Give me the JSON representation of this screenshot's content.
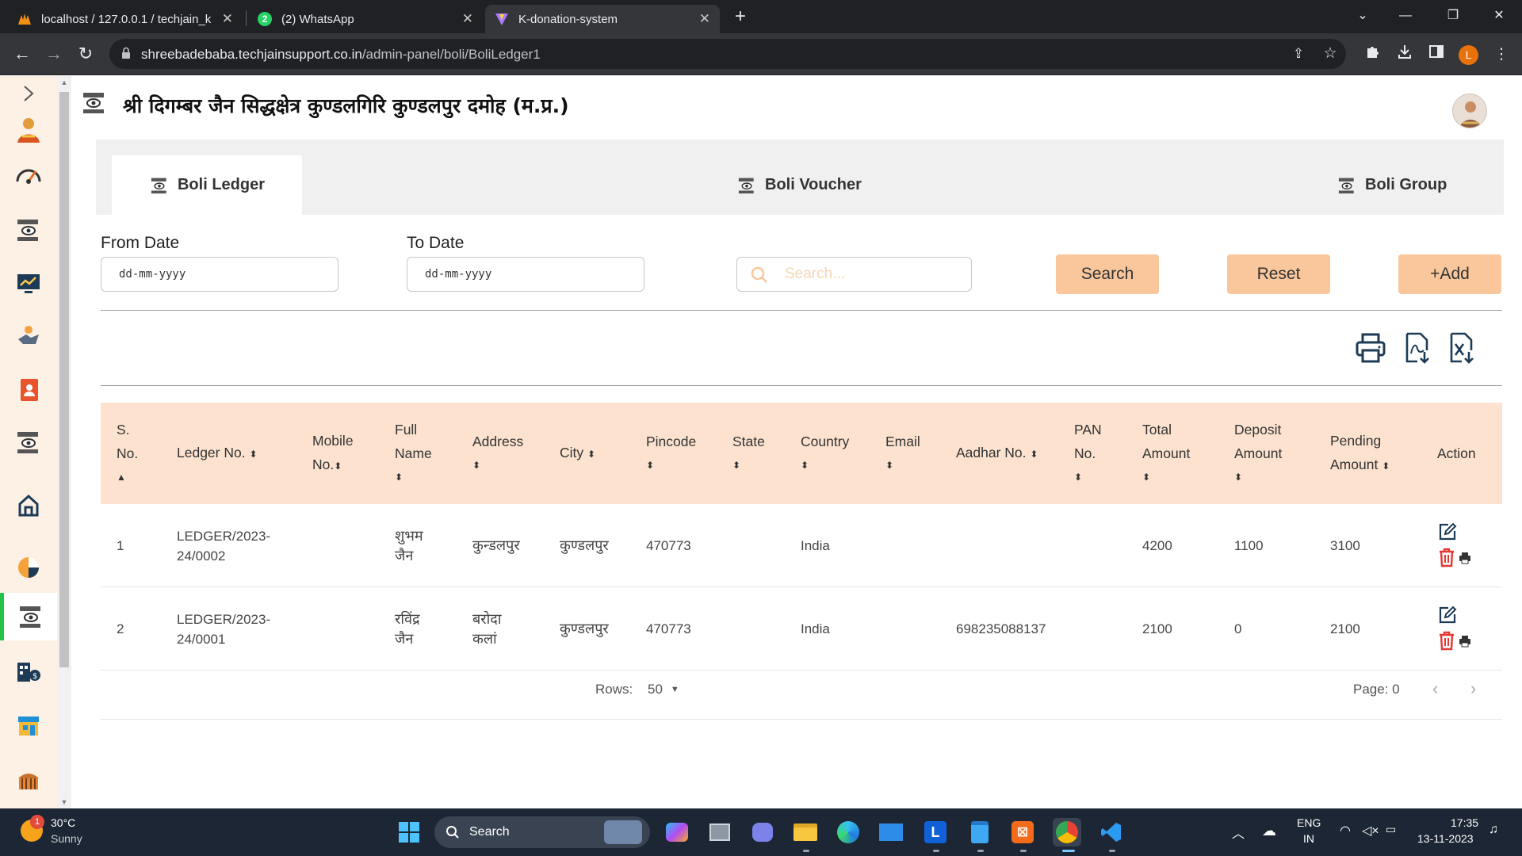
{
  "browser": {
    "tabs": [
      {
        "title": "localhost / 127.0.0.1 / techjain_k",
        "active": false
      },
      {
        "title": "(2) WhatsApp",
        "active": false,
        "badge": "2"
      },
      {
        "title": "K-donation-system",
        "active": true
      }
    ],
    "url_host": "shreebadebaba.techjainsupport.co.in",
    "url_path": "/admin-panel/boli/BoliLedger1",
    "profile_initial": "L"
  },
  "header": {
    "title": "श्री दिगम्बर जैन सिद्धक्षेत्र कुण्डलगिरि कुण्डलपुर दमोह (म.प्र.)"
  },
  "page_tabs": [
    {
      "label": "Boli Ledger",
      "active": true
    },
    {
      "label": "Boli Voucher",
      "active": false
    },
    {
      "label": "Boli Group",
      "active": false
    }
  ],
  "filters": {
    "from_label": "From Date",
    "to_label": "To Date",
    "date_placeholder": "dd-mm-yyyy",
    "search_placeholder": "Search...",
    "search_button": "Search",
    "reset_button": "Reset",
    "add_button": "+Add"
  },
  "table": {
    "headers": [
      [
        "S.",
        "No."
      ],
      [
        "Ledger No."
      ],
      [
        "Mobile",
        "No."
      ],
      [
        "Full",
        "Name"
      ],
      [
        "Address"
      ],
      [
        "City"
      ],
      [
        "Pincode"
      ],
      [
        "State"
      ],
      [
        "Country"
      ],
      [
        "Email"
      ],
      [
        "Aadhar No."
      ],
      [
        "PAN",
        "No."
      ],
      [
        "Total",
        "Amount"
      ],
      [
        "Deposit",
        "Amount"
      ],
      [
        "Pending",
        "Amount"
      ],
      [
        "Action"
      ]
    ],
    "rows": [
      {
        "sno": "1",
        "ledger": [
          "LEDGER/2023-",
          "24/0002"
        ],
        "mobile": "",
        "name": [
          "शुभम",
          "जैन"
        ],
        "address": "कुन्डलपुर",
        "city": "कुण्डलपुर",
        "pincode": "470773",
        "state": "",
        "country": "India",
        "email": "",
        "aadhar": "",
        "pan": "",
        "total": "4200",
        "deposit": "1100",
        "pending": "3100"
      },
      {
        "sno": "2",
        "ledger": [
          "LEDGER/2023-",
          "24/0001"
        ],
        "mobile": "",
        "name": [
          "रविंद्र",
          "जैन"
        ],
        "address": [
          "बरोदा",
          "कलां"
        ],
        "city": "कुण्डलपुर",
        "pincode": "470773",
        "state": "",
        "country": "India",
        "email": "",
        "aadhar": "698235088137",
        "pan": "",
        "total": "2100",
        "deposit": "0",
        "pending": "2100"
      }
    ]
  },
  "pager": {
    "rows_label": "Rows:",
    "rows_value": "50",
    "page_label": "Page: 0"
  },
  "taskbar": {
    "weather_temp": "30°C",
    "weather_desc": "Sunny",
    "weather_badge": "1",
    "search_label": "Search",
    "lang_1": "ENG",
    "lang_2": "IN",
    "time": "17:35",
    "date": "13-11-2023"
  },
  "colors": {
    "accent": "#f9c79b",
    "table_header": "#fde3cf",
    "sidebar_bg": "#fdf1e5",
    "active_marker": "#25c24a",
    "delete_red": "#e53935"
  }
}
